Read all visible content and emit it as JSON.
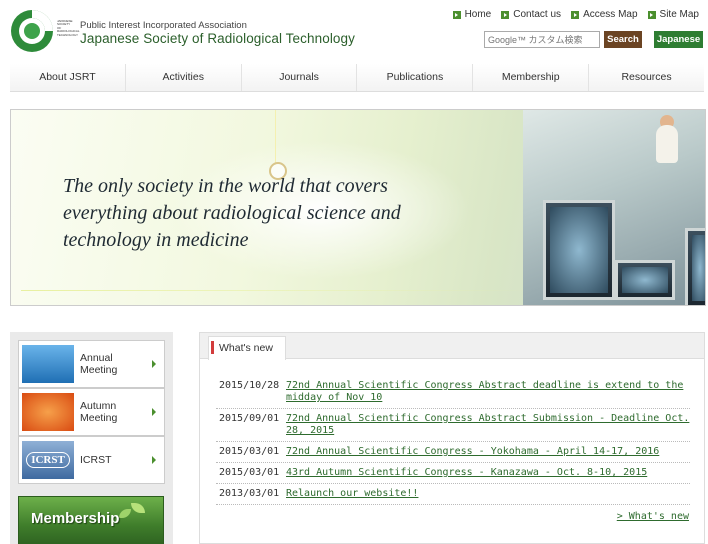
{
  "header": {
    "logo_lines": [
      "JAPANESE",
      "SOCIETY",
      "OF",
      "RADIOLOGICAL",
      "TECHNOLOGY"
    ],
    "org_subtitle": "Public Interest Incorporated Association",
    "org_name": "Japanese Society of Radiological Technology",
    "utility_links": [
      "Home",
      "Contact us",
      "Access Map",
      "Site Map"
    ],
    "search_placeholder": "Google™ カスタム検索",
    "search_button": "Search",
    "language_button": "Japanese"
  },
  "nav": {
    "items": [
      "About JSRT",
      "Activities",
      "Journals",
      "Publications",
      "Membership",
      "Resources"
    ]
  },
  "banner": {
    "lines": [
      "The only society in the world that covers",
      "everything about radiological science and",
      "technology in medicine"
    ]
  },
  "sidebar": {
    "items": [
      {
        "label": "Annual Meeting",
        "thumb_color": "#3a8fd4"
      },
      {
        "label": "Autumn Meeting",
        "thumb_color": "#e8621c"
      },
      {
        "label": "ICRST",
        "thumb_color": "#5a86b8"
      }
    ],
    "membership_label": "Membership",
    "icrst_thumb_text": "ICRST"
  },
  "news": {
    "tab_label": "What's new",
    "items": [
      {
        "date": "2015/10/28",
        "title": "72nd Annual Scientific Congress Abstract deadline is extend to the midday of Nov 10"
      },
      {
        "date": "2015/09/01",
        "title": "72nd Annual Scientific Congress Abstract Submission - Deadline Oct. 28, 2015"
      },
      {
        "date": "2015/03/01",
        "title": "72nd Annual Scientific Congress - Yokohama - April 14-17, 2016"
      },
      {
        "date": "2015/03/01",
        "title": "43rd Autumn Scientific Congress - Kanazawa - Oct. 8-10, 2015"
      },
      {
        "date": "2013/03/01",
        "title": "Relaunch our website!!"
      }
    ],
    "more_link": "> What's new"
  },
  "colors": {
    "brand_green": "#2e7d32",
    "search_brown": "#6b4423",
    "link_green": "#2e6b2e",
    "accent_red": "#d23c3c"
  }
}
